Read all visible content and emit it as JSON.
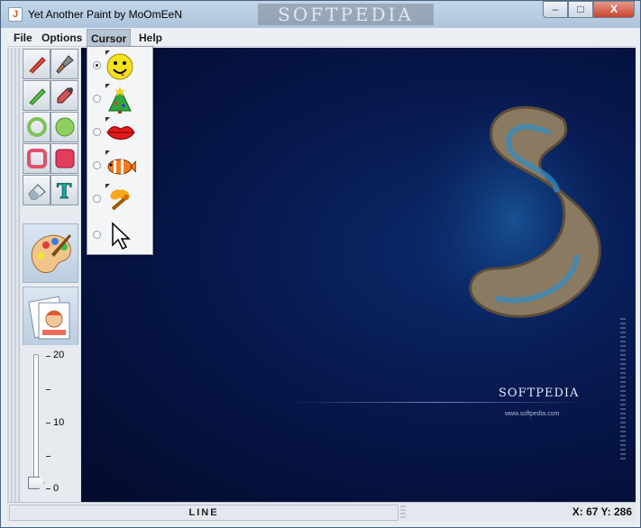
{
  "window": {
    "title": "Yet Another Paint by MoOmEeN",
    "watermark": "SOFTPEDIA"
  },
  "window_controls": {
    "minimize": "–",
    "maximize": "□",
    "close": "X"
  },
  "menubar": {
    "items": [
      "File",
      "Options",
      "Cursor",
      "Help"
    ],
    "active": "Cursor"
  },
  "cursor_menu": {
    "items": [
      {
        "icon": "smiley-icon",
        "selected": true
      },
      {
        "icon": "christmas-tree-icon",
        "selected": false
      },
      {
        "icon": "lips-icon",
        "selected": false
      },
      {
        "icon": "clownfish-icon",
        "selected": false
      },
      {
        "icon": "bee-icon",
        "selected": false
      },
      {
        "icon": "arrow-pointer-icon",
        "selected": false
      }
    ]
  },
  "tools": [
    {
      "icon": "pencil-icon"
    },
    {
      "icon": "brush-icon"
    },
    {
      "icon": "line-icon"
    },
    {
      "icon": "eyedropper-icon"
    },
    {
      "icon": "ellipse-outline-icon"
    },
    {
      "icon": "ellipse-filled-icon"
    },
    {
      "icon": "rectangle-outline-icon"
    },
    {
      "icon": "rectangle-filled-icon"
    },
    {
      "icon": "eraser-icon"
    },
    {
      "icon": "text-icon"
    }
  ],
  "side_buttons": [
    {
      "icon": "palette-icon"
    },
    {
      "icon": "image-open-icon"
    }
  ],
  "brush_size": {
    "max_label": "20",
    "mid_label": "10",
    "min_label": "0",
    "value": 0
  },
  "canvas_watermark": {
    "logo": "SOFTPEDIA",
    "url": "www.softpedia.com"
  },
  "status": {
    "tool": "LINE",
    "coords": "X: 67 Y: 286"
  }
}
